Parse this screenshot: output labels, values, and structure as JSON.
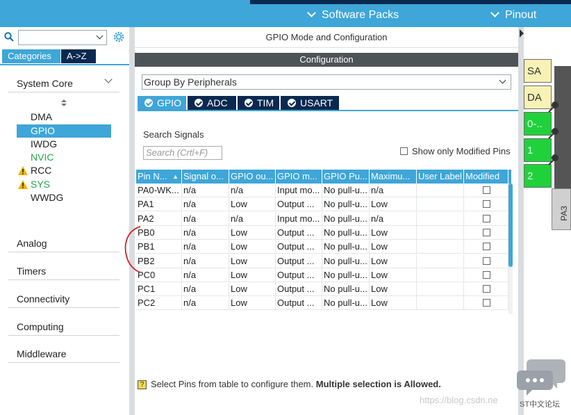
{
  "topbar": {
    "tabs": [
      {
        "label": "Software Packs"
      },
      {
        "label": "Pinout"
      }
    ]
  },
  "left": {
    "search": {
      "value": "",
      "placeholder": ""
    },
    "tabs": [
      {
        "label": "Categories"
      },
      {
        "label": "A->Z"
      }
    ],
    "sections": [
      {
        "label": "System Core"
      },
      {
        "label": "Analog"
      },
      {
        "label": "Timers"
      },
      {
        "label": "Connectivity"
      },
      {
        "label": "Computing"
      },
      {
        "label": "Middleware"
      }
    ],
    "system_core_items": [
      {
        "label": "DMA",
        "state": "normal"
      },
      {
        "label": "GPIO",
        "state": "selected"
      },
      {
        "label": "IWDG",
        "state": "normal"
      },
      {
        "label": "NVIC",
        "state": "green"
      },
      {
        "label": "RCC",
        "state": "warning"
      },
      {
        "label": "SYS",
        "state": "warning-green"
      },
      {
        "label": "WWDG",
        "state": "normal"
      }
    ]
  },
  "main": {
    "title": "GPIO Mode and Configuration",
    "config_header": "Configuration",
    "group_by": "Group By Peripherals",
    "peripheral_tabs": [
      {
        "label": "GPIO"
      },
      {
        "label": "ADC"
      },
      {
        "label": "TIM"
      },
      {
        "label": "USART"
      }
    ],
    "search_signals_label": "Search Signals",
    "search_placeholder": "Search (Crtl+F)",
    "show_modified_label": "Show only Modified Pins",
    "columns": [
      "Pin N...",
      "Signal o...",
      "GPIO ou...",
      "GPIO m...",
      "GPIO Pu...",
      "Maximu...",
      "User Label",
      "Modified"
    ],
    "rows": [
      [
        "PA0-WK...",
        "n/a",
        "n/a",
        "Input mo...",
        "No pull-u...",
        "n/a",
        ""
      ],
      [
        "PA1",
        "n/a",
        "Low",
        "Output ...",
        "No pull-u...",
        "Low",
        ""
      ],
      [
        "PA2",
        "n/a",
        "n/a",
        "Input mo...",
        "No pull-u...",
        "n/a",
        ""
      ],
      [
        "PB0",
        "n/a",
        "Low",
        "Output ...",
        "No pull-u...",
        "Low",
        ""
      ],
      [
        "PB1",
        "n/a",
        "Low",
        "Output ...",
        "No pull-u...",
        "Low",
        ""
      ],
      [
        "PB2",
        "n/a",
        "Low",
        "Output ...",
        "No pull-u...",
        "Low",
        ""
      ],
      [
        "PC0",
        "n/a",
        "Low",
        "Output ...",
        "No pull-u...",
        "Low",
        ""
      ],
      [
        "PC1",
        "n/a",
        "Low",
        "Output ...",
        "No pull-u...",
        "Low",
        ""
      ],
      [
        "PC2",
        "n/a",
        "Low",
        "Output ...",
        "No pull-u...",
        "Low",
        ""
      ]
    ],
    "hint_normal": "Select Pins from table to configure them.",
    "hint_bold": "Multiple selection is Allowed."
  },
  "pinout": {
    "pins": [
      {
        "label": "SA",
        "color": "yellow"
      },
      {
        "label": "DA",
        "color": "yellow"
      },
      {
        "label": "0-..",
        "color": "green"
      },
      {
        "label": "1",
        "color": "green"
      },
      {
        "label": "2",
        "color": "green"
      }
    ],
    "bottom_pin": "PA3"
  },
  "watermark": {
    "url": "https://blog.csdn.ne",
    "brand": "ST中文论坛"
  },
  "colors": {
    "accent": "#3ea6d8",
    "dark": "#0b2950",
    "pin_green": "#1fd23b",
    "pin_yellow": "#f8f2b6"
  }
}
